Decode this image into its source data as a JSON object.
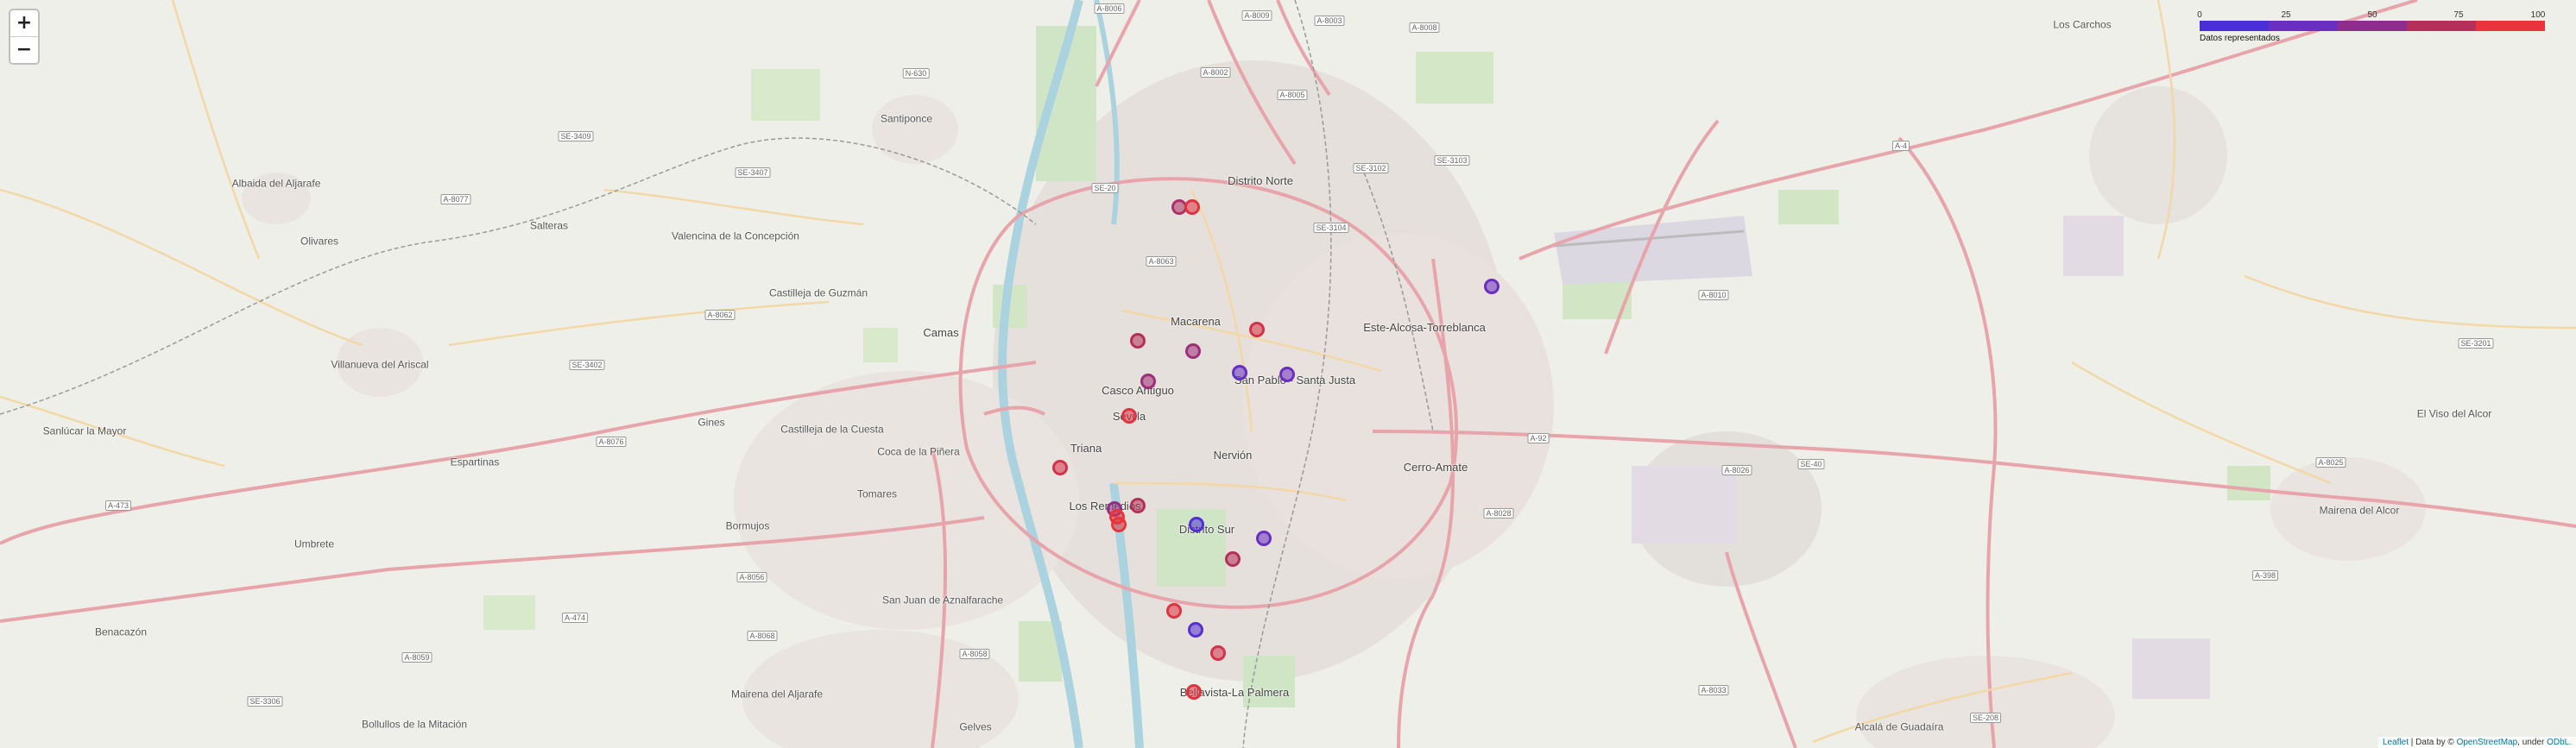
{
  "map": {
    "zoom_in": "+",
    "zoom_out": "−",
    "legend": {
      "ticks": [
        "0",
        "25",
        "50",
        "75",
        "100"
      ],
      "caption": "Datos representados",
      "colors": [
        "#4b2fd6",
        "#6a2fc0",
        "#8f2d8f",
        "#b42f5a",
        "#e8343a"
      ]
    },
    "attribution": {
      "leaflet": "Leaflet",
      "text1": " | Data by © ",
      "osm": "OpenStreetMap",
      "text2": ", under ",
      "odbl": "ODbL."
    },
    "labels": [
      "Distrito Norte",
      "Macarena",
      "Casco Antiguo",
      "Sevilla",
      "Triana",
      "Los Remedios",
      "Nervión",
      "San Pablo - Santa Justa",
      "Distrito Sur",
      "Cerro-Amate",
      "Bellavista-La Palmera",
      "Este-Alcosa-Torreblanca",
      "Camas",
      "Santiponce",
      "Salteras",
      "Olivares",
      "Albaida del Aljarafe",
      "Valencina de la Concepción",
      "Castilleja de Guzmán",
      "Villanueva del Ariscal",
      "Sanlúcar la Mayor",
      "Espartinas",
      "Gines",
      "Castilleja de la Cuesta",
      "Coca de la Piñera",
      "Tomares",
      "Bormujos",
      "Umbrete",
      "Benacazón",
      "San Juan de Aznalfarache",
      "Mairena del Aljarafe",
      "Gelves",
      "Bollullos de la Mitación",
      "Alcalá de Guadaíra",
      "Mairena del Alcor",
      "El Viso del Alcor",
      "Los Carchos"
    ],
    "roads": [
      "A-8006",
      "A-8009",
      "A-8003",
      "A-8008",
      "A-8002",
      "A-8005",
      "N-630",
      "SE-3409",
      "SE-3407",
      "SE-20",
      "A-8077",
      "A-8062",
      "SE-3102",
      "SE-3103",
      "SE-3104",
      "A-8063",
      "A-4",
      "A-8010",
      "SE-3201",
      "A-92",
      "A-8026",
      "SE-40",
      "A-8025",
      "A-8028",
      "A-8076",
      "A-473",
      "A-8058",
      "A-8056",
      "A-474",
      "A-8068",
      "A-8059",
      "SE-3306",
      "A-8033",
      "SE-208",
      "A-398",
      "SE-3402"
    ],
    "data_points": [
      {
        "value": 70
      },
      {
        "value": 95
      },
      {
        "value": 25
      },
      {
        "value": 90
      },
      {
        "value": 75
      },
      {
        "value": 60
      },
      {
        "value": 20
      },
      {
        "value": 25
      },
      {
        "value": 60
      },
      {
        "value": 95
      },
      {
        "value": 90
      },
      {
        "value": 55
      },
      {
        "value": 75
      },
      {
        "value": 100
      },
      {
        "value": 100
      },
      {
        "value": 5
      },
      {
        "value": 25
      },
      {
        "value": 75
      },
      {
        "value": 95
      },
      {
        "value": 10
      },
      {
        "value": 90
      },
      {
        "value": 95
      }
    ]
  }
}
